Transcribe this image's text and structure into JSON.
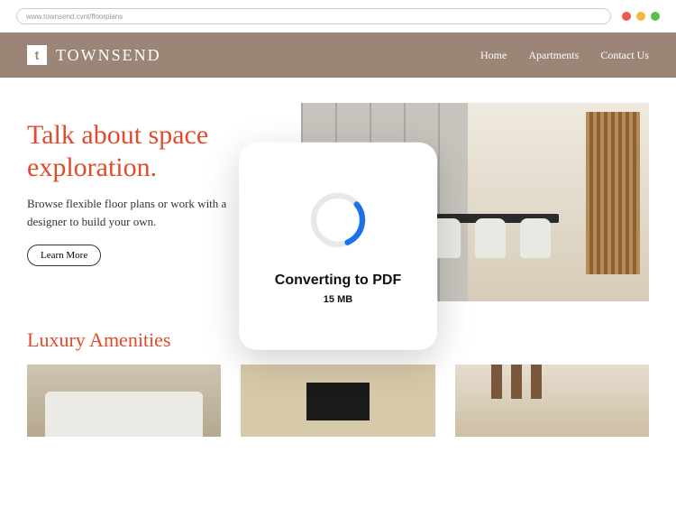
{
  "browser": {
    "url": "www.townsend.cvnt/floorplans"
  },
  "brand": {
    "name": "TOWNSEND",
    "icon_letter": "t"
  },
  "nav": {
    "items": [
      "Home",
      "Apartments",
      "Contact Us"
    ]
  },
  "hero": {
    "title_line1": "Talk about space",
    "title_line2": "exploration.",
    "subtitle": "Browse flexible floor plans or work with a designer to build your own.",
    "cta": "Learn More"
  },
  "amenities": {
    "title": "Luxury Amenities"
  },
  "modal": {
    "title": "Converting to PDF",
    "size": "15 MB"
  }
}
